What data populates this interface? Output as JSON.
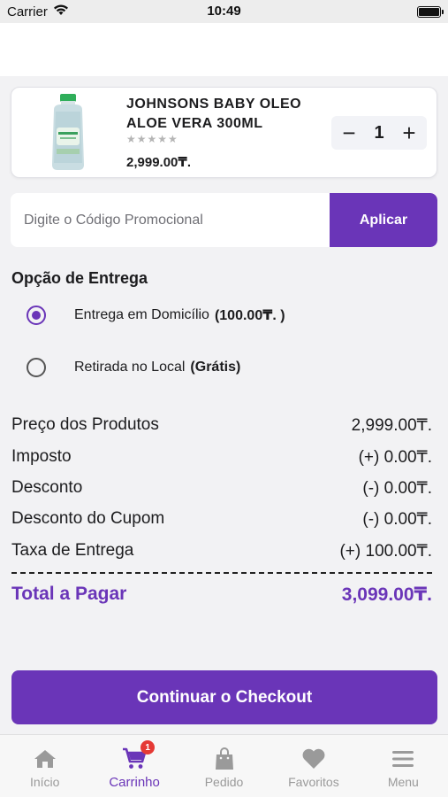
{
  "status_bar": {
    "carrier": "Carrier",
    "time": "10:49"
  },
  "cart_item": {
    "name": "JOHNSONS BABY OLEO ALOE VERA 300ML",
    "stars": "★★★★★",
    "rating": 0,
    "price": "2,999.00₸.",
    "quantity": "1",
    "minus_label": "−",
    "plus_label": "+"
  },
  "promo": {
    "placeholder": "Digite o Código Promocional",
    "button_label": "Aplicar"
  },
  "delivery": {
    "title": "Opção de Entrega",
    "options": [
      {
        "label": "Entrega em Domicílio",
        "extra": "(100.00₸. )",
        "selected": true
      },
      {
        "label": "Retirada no Local",
        "extra": "(Grátis)",
        "selected": false
      }
    ]
  },
  "summary": {
    "rows": [
      {
        "label": "Preço dos Produtos",
        "value": "2,999.00₸."
      },
      {
        "label": "Imposto",
        "value": "(+) 0.00₸."
      },
      {
        "label": "Desconto",
        "value": "(-) 0.00₸."
      },
      {
        "label": "Desconto do Cupom",
        "value": "(-) 0.00₸."
      },
      {
        "label": "Taxa de Entrega",
        "value": "(+) 100.00₸."
      }
    ],
    "total_label": "Total a Pagar",
    "total_value": "3,099.00₸."
  },
  "checkout_label": "Continuar o Checkout",
  "tabs": [
    {
      "label": "Início",
      "icon": "home-icon",
      "active": false
    },
    {
      "label": "Carrinho",
      "icon": "cart-icon",
      "active": true,
      "badge": "1"
    },
    {
      "label": "Pedido",
      "icon": "shopping-bag-icon",
      "active": false
    },
    {
      "label": "Favoritos",
      "icon": "heart-icon",
      "active": false
    },
    {
      "label": "Menu",
      "icon": "menu-icon",
      "active": false
    }
  ],
  "colors": {
    "accent": "#6a35b8",
    "badge": "#e53935",
    "inactive_tab": "#9a9a9a"
  }
}
